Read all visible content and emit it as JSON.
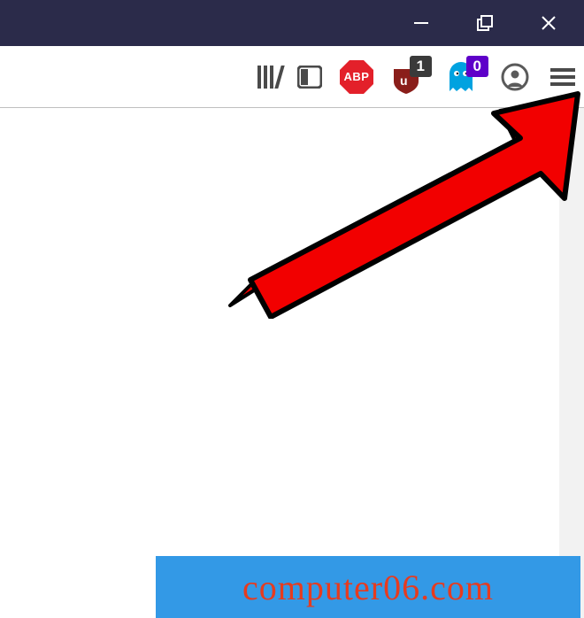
{
  "toolbar": {
    "abp_label": "ABP",
    "ublock_badge": "1",
    "ghostery_badge": "0"
  },
  "watermark": "computer06.com"
}
